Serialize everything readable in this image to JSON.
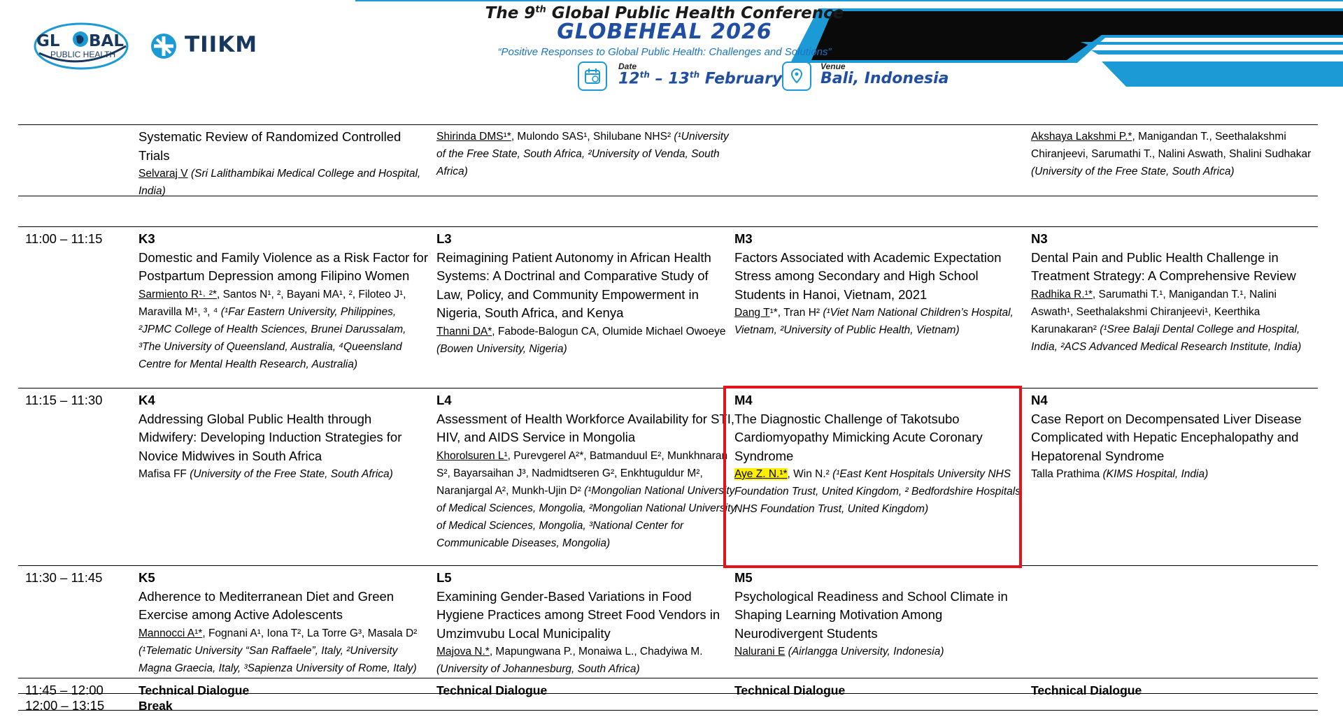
{
  "header": {
    "title_prefix": "The 9",
    "title_sup": "th",
    "title_rest": " Global Public Health Conference",
    "name": "GLOBEHEAL 2026",
    "theme": "“Positive Responses to Global Public Health: Challenges and Solutions”",
    "date_label": "Date",
    "date_a": "12",
    "date_a_sup": "th",
    "date_b": " – 13",
    "date_b_sup": "th",
    "date_c": " February",
    "venue_label": "Venue",
    "venue_value": "Bali, Indonesia",
    "logo_global_1": "GL",
    "logo_global_2": "BAL",
    "logo_global_3": "PUBLIC HEALTH",
    "logo_tiikm": "TIIKM"
  },
  "colors": {
    "brand_blue": "#1f4ea3",
    "accent_blue": "#1b9ad6",
    "highlight_box": "#e2141e",
    "highlight_text": "#ffee00"
  },
  "rows": [
    {
      "time": "",
      "cells": [
        {
          "code": "",
          "title": "Systematic Review of Randomized Controlled Trials",
          "authors": [
            {
              "t": "Selvaraj V",
              "u": true
            },
            {
              "t": " (Sri Lalithambikai Medical College and Hospital, India)",
              "i": true
            }
          ]
        },
        {
          "code": "",
          "title": "",
          "authors": [
            {
              "t": "Shirinda DMS¹*",
              "u": true
            },
            {
              "t": ", Mulondo SAS¹, Shilubane NHS²"
            },
            {
              "t": " (¹University of the Free State, South Africa, ²University of Venda, South Africa)",
              "i": true
            }
          ]
        },
        {
          "code": "",
          "title": "",
          "authors": []
        },
        {
          "code": "",
          "title": "",
          "authors": [
            {
              "t": "Akshaya Lakshmi P.*",
              "u": true
            },
            {
              "t": ", Manigandan T., Seethalakshmi Chiranjeevi, Sarumathi T., Nalini Aswath, Shalini Sudhakar"
            },
            {
              "t": " (University of the Free State, South Africa)",
              "i": true
            }
          ]
        }
      ]
    },
    {
      "time": "11:00 – 11:15",
      "cells": [
        {
          "code": "K3",
          "title": "Domestic and Family Violence as a Risk Factor for Postpartum Depression among Filipino Women",
          "authors": [
            {
              "t": "Sarmiento R¹˒ ²*",
              "u": true
            },
            {
              "t": ", Santos N¹, ², Bayani MA¹, ², Filoteo J¹, Maravilla M¹, ³, ⁴"
            },
            {
              "t": " (¹Far Eastern University, Philippines, ²JPMC College of Health Sciences, Brunei Darussalam, ³The University of Queensland, Australia, ⁴Queensland Centre for Mental Health Research, Australia)",
              "i": true
            }
          ]
        },
        {
          "code": "L3",
          "title": "Reimagining Patient Autonomy in African Health Systems: A Doctrinal and Comparative Study of Law, Policy, and Community Empowerment in Nigeria, South Africa, and Kenya",
          "authors": [
            {
              "t": "Thanni DA*",
              "u": true
            },
            {
              "t": ", Fabode-Balogun CA, Olumide Michael Owoeye"
            },
            {
              "t": " (Bowen University, Nigeria)",
              "i": true
            }
          ]
        },
        {
          "code": "M3",
          "title": "Factors Associated with Academic Expectation Stress among Secondary and High School Students in Hanoi, Vietnam, 2021",
          "authors": [
            {
              "t": "Dang T",
              "u": true
            },
            {
              "t": "¹*, Tran H²"
            },
            {
              "t": " (¹Viet Nam National Children’s Hospital, Vietnam, ²University of Public Health, Vietnam)",
              "i": true
            }
          ]
        },
        {
          "code": "N3",
          "title": "Dental Pain and Public Health Challenge in Treatment Strategy: A Comprehensive Review",
          "authors": [
            {
              "t": "Radhika R.¹*",
              "u": true
            },
            {
              "t": ", Sarumathi T.¹, Manigandan T.¹, Nalini Aswath¹, Seethalakshmi Chiranjeevi¹, Keerthika Karunakaran²"
            },
            {
              "t": " (¹Sree Balaji Dental College and Hospital, India, ²ACS Advanced Medical Research Institute, India)",
              "i": true
            }
          ]
        }
      ]
    },
    {
      "time": "11:15 – 11:30",
      "cells": [
        {
          "code": "K4",
          "title": "Addressing Global Public Health through Midwifery: Developing Induction Strategies for Novice Midwives in South Africa",
          "authors": [
            {
              "t": "Mafisa FF"
            },
            {
              "t": " (University of the Free State, South Africa)",
              "i": true
            }
          ]
        },
        {
          "code": "L4",
          "title": "Assessment of Health Workforce Availability for STI, HIV, and AIDS Service in Mongolia",
          "authors": [
            {
              "t": "Khorolsuren L¹",
              "u": true
            },
            {
              "t": ", Purevgerel A²*, Batmanduul E², Munkhnaran S², Bayarsaihan J³, Nadmidtseren G², Enkhtuguldur M², Naranjargal A², Munkh-Ujin D²"
            },
            {
              "t": " (¹Mongolian National University of Medical Sciences, Mongolia, ²Mongolian National University of Medical Sciences, Mongolia, ³National Center for Communicable Diseases, Mongolia)",
              "i": true
            }
          ]
        },
        {
          "code": "M4",
          "title": "The Diagnostic Challenge of Takotsubo Cardiomyopathy Mimicking Acute Coronary Syndrome",
          "authors": [
            {
              "t": "Aye Z. N.¹*",
              "u": true,
              "hl": true
            },
            {
              "t": ", Win N.²"
            },
            {
              "t": " (¹East Kent Hospitals University NHS Foundation Trust, United Kingdom, ² Bedfordshire Hospitals NHS Foundation Trust, United Kingdom)",
              "i": true
            }
          ]
        },
        {
          "code": "N4",
          "title": "Case Report on Decompensated Liver Disease Complicated with Hepatic Encephalopathy and Hepatorenal Syndrome",
          "authors": [
            {
              "t": "Talla Prathima"
            },
            {
              "t": " (KIMS Hospital, India)",
              "i": true
            }
          ]
        }
      ]
    },
    {
      "time": "11:30 – 11:45",
      "cells": [
        {
          "code": "K5",
          "title": "Adherence to Mediterranean Diet and Green Exercise among Active Adolescents",
          "authors": [
            {
              "t": "Mannocci A¹*",
              "u": true
            },
            {
              "t": ", Fognani A¹, Iona T², La Torre G³, Masala D²"
            },
            {
              "t": " (¹Telematic University “San Raffaele”, Italy, ²University Magna Graecia, Italy, ³Sapienza University of Rome, Italy)",
              "i": true
            }
          ]
        },
        {
          "code": "L5",
          "title": "Examining Gender-Based Variations in Food Hygiene Practices among Street Food Vendors in Umzimvubu Local Municipality",
          "authors": [
            {
              "t": "Majova N.*",
              "u": true
            },
            {
              "t": ", Mapungwana P., Monaiwa L., Chadyiwa M."
            },
            {
              "t": " (University of Johannesburg, South Africa)",
              "i": true
            }
          ]
        },
        {
          "code": "M5",
          "title": "Psychological Readiness and School Climate in Shaping Learning Motivation Among Neurodivergent Students",
          "authors": [
            {
              "t": "Nalurani E",
              "u": true
            },
            {
              "t": "  (Airlangga University, Indonesia)",
              "i": true
            }
          ]
        },
        {
          "code": "",
          "title": "",
          "authors": []
        }
      ]
    },
    {
      "time": "11:45 – 12:00",
      "cells": [
        {
          "bold": "Technical Dialogue"
        },
        {
          "bold": "Technical Dialogue"
        },
        {
          "bold": "Technical Dialogue"
        },
        {
          "bold": "Technical Dialogue"
        }
      ]
    },
    {
      "time": "12:00 – 13:15",
      "cells": [
        {
          "bold": "Break"
        },
        {
          "bold": ""
        },
        {
          "bold": ""
        },
        {
          "bold": ""
        }
      ]
    }
  ]
}
